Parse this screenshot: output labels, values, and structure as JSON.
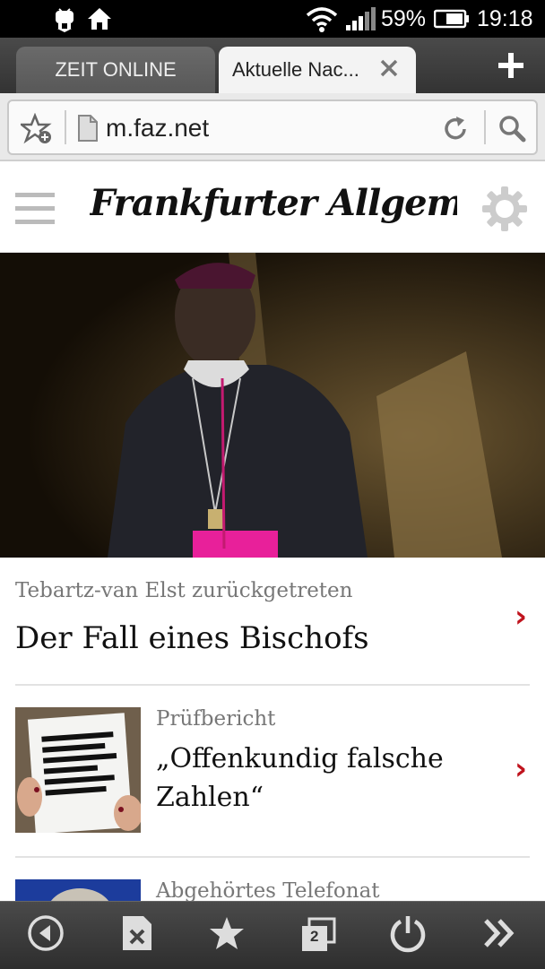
{
  "status": {
    "battery_percent": "59%",
    "time": "19:18"
  },
  "tabs": [
    {
      "label": "ZEIT ONLINE"
    },
    {
      "label": "Aktuelle Nac...",
      "active": true
    }
  ],
  "address": {
    "url": "m.faz.net"
  },
  "site": {
    "logo_text": "Frankfurter Allgemeine"
  },
  "articles": [
    {
      "kicker": "Tebartz-van Elst zurückgetreten",
      "headline": "Der Fall eines Bischofs"
    },
    {
      "kicker": "Prüfbericht",
      "headline": "„Offenkundig falsche Zahlen“"
    },
    {
      "kicker": "Abgehörtes Telefonat",
      "headline": ""
    }
  ],
  "bottom_bar": {
    "tab_count": "2"
  },
  "colors": {
    "accent_red": "#c0141e",
    "pink_sash": "#e8209a"
  }
}
